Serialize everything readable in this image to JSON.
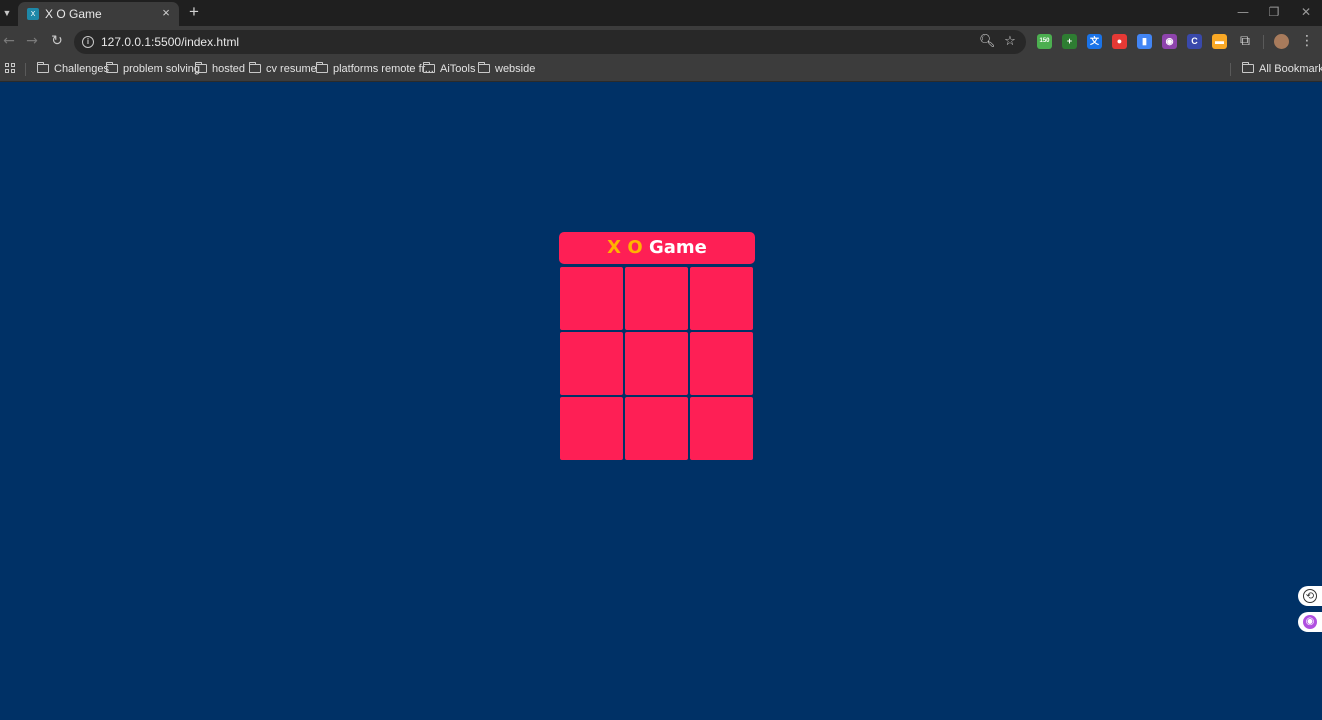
{
  "browser": {
    "tab_title": "X O Game",
    "favicon_glyph": "X",
    "url": "127.0.0.1:5500/index.html",
    "bookmarks": [
      "Challenges",
      "problem solving",
      "hosted",
      "cv resume",
      "platforms remote fr...",
      "AiTools",
      "webside"
    ],
    "all_bookmarks_label": "All Bookmarks",
    "extensions": [
      {
        "name": "counter-extension-icon",
        "label": "150",
        "color": "#4caf50"
      },
      {
        "name": "plus-extension-icon",
        "label": "+",
        "color": "#2e7d32"
      },
      {
        "name": "translate-extension-icon",
        "label": "文",
        "color": "#1a73e8"
      },
      {
        "name": "record-extension-icon",
        "label": "●",
        "color": "#e53935"
      },
      {
        "name": "docs-extension-icon",
        "label": "▮",
        "color": "#4285f4"
      },
      {
        "name": "brain-extension-icon",
        "label": "◉",
        "color": "#8e44ad"
      },
      {
        "name": "c-extension-icon",
        "label": "C",
        "color": "#3949ab"
      },
      {
        "name": "tag-extension-icon",
        "label": "▬",
        "color": "#f9a825"
      }
    ]
  },
  "page": {
    "background": "#003166",
    "accent": "#fe1f55",
    "title_x": "X",
    "title_o": "O",
    "title_word": "Game",
    "title_letter_color": "#ffb300",
    "cells": [
      "",
      "",
      "",
      "",
      "",
      "",
      "",
      "",
      ""
    ]
  }
}
